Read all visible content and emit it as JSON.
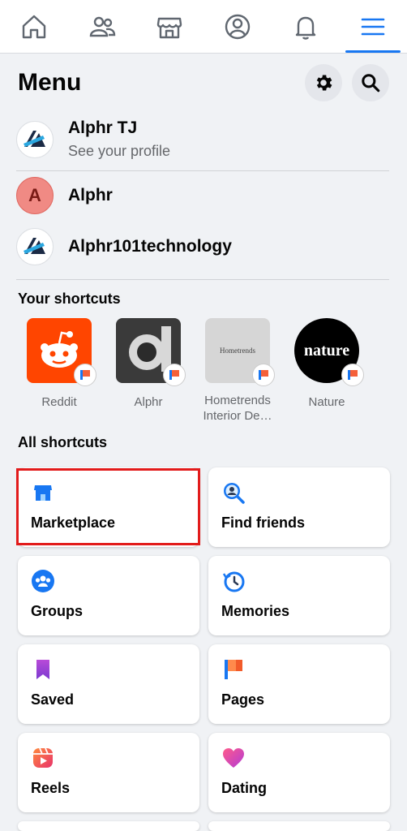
{
  "nav": {
    "tabs": [
      {
        "name": "home",
        "icon": "home-icon"
      },
      {
        "name": "friends",
        "icon": "friends-icon"
      },
      {
        "name": "marketplace",
        "icon": "store-icon"
      },
      {
        "name": "profile",
        "icon": "profile-icon"
      },
      {
        "name": "notifications",
        "icon": "bell-icon"
      },
      {
        "name": "menu",
        "icon": "menu-icon",
        "active": true
      }
    ]
  },
  "header": {
    "title": "Menu"
  },
  "profile": {
    "name": "Alphr TJ",
    "sub": "See your profile"
  },
  "pages": [
    {
      "name": "Alphr",
      "initial": "A"
    },
    {
      "name": "Alphr101technology"
    }
  ],
  "shortcuts": {
    "title": "Your shortcuts",
    "items": [
      {
        "label": "Reddit"
      },
      {
        "label": "Alphr"
      },
      {
        "label": "Hometrends Interior De…",
        "logo_text": "Hometrends"
      },
      {
        "label": "Nature",
        "logo_text": "nature"
      }
    ]
  },
  "all_shortcuts": {
    "title": "All shortcuts",
    "cards": [
      {
        "label": "Marketplace",
        "icon": "marketplace-icon"
      },
      {
        "label": "Find friends",
        "icon": "find-friends-icon"
      },
      {
        "label": "Groups",
        "icon": "groups-icon"
      },
      {
        "label": "Memories",
        "icon": "memories-icon"
      },
      {
        "label": "Saved",
        "icon": "saved-icon"
      },
      {
        "label": "Pages",
        "icon": "pages-icon"
      },
      {
        "label": "Reels",
        "icon": "reels-icon"
      },
      {
        "label": "Dating",
        "icon": "dating-icon"
      }
    ]
  },
  "colors": {
    "accent": "#1877f2",
    "highlight": "#e21b1b"
  }
}
